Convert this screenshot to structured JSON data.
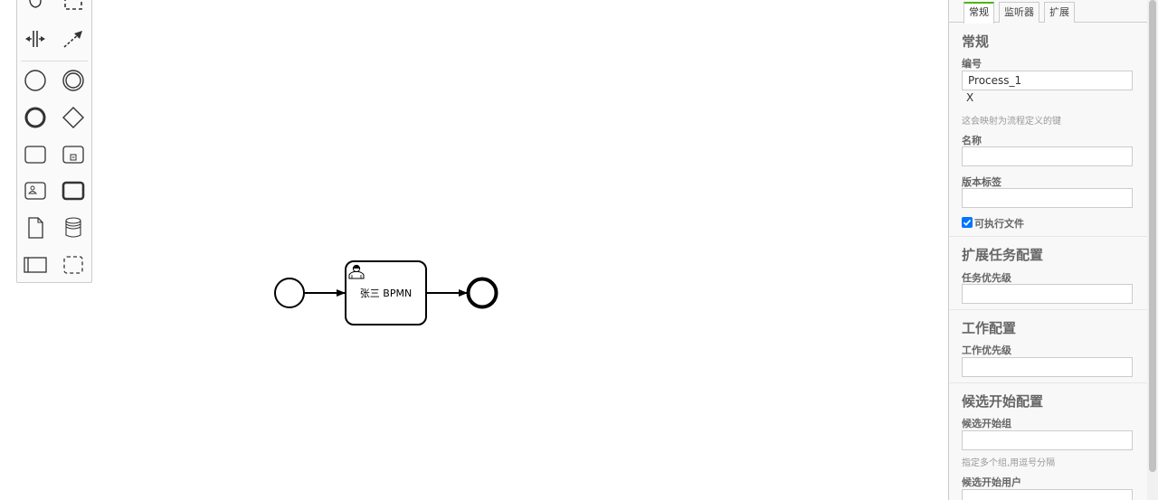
{
  "tabs": [
    "常规",
    "监听器",
    "扩展"
  ],
  "general": {
    "title": "常规",
    "id_label": "编号",
    "id_value": "Process_1",
    "clear_glyph": "X",
    "id_hint": "这会映射为流程定义的键",
    "name_label": "名称",
    "name_value": "",
    "version_label": "版本标签",
    "version_value": "",
    "executable_label": "可执行文件",
    "executable_checked": true
  },
  "ext_task": {
    "title": "扩展任务配置",
    "priority_label": "任务优先级",
    "priority_value": ""
  },
  "job": {
    "title": "工作配置",
    "priority_label": "工作优先级",
    "priority_value": ""
  },
  "starter": {
    "title": "候选开始配置",
    "groups_label": "候选开始组",
    "groups_value": "",
    "groups_hint": "指定多个组,用逗号分隔",
    "users_label": "候选开始用户"
  },
  "diagram": {
    "task_label": "张三 BPMN"
  },
  "colors": {
    "tab_accent": "#52b415",
    "checkbox": "#0075ff"
  },
  "palette_icons": [
    "hand-tool-icon",
    "lasso-tool-icon",
    "space-tool-icon",
    "global-connect-icon",
    "start-event-icon",
    "intermediate-event-icon",
    "end-event-icon",
    "gateway-icon",
    "task-icon",
    "subprocess-icon",
    "user-task-icon",
    "call-activity-icon",
    "data-object-icon",
    "data-store-icon",
    "pool-icon",
    "group-icon"
  ]
}
